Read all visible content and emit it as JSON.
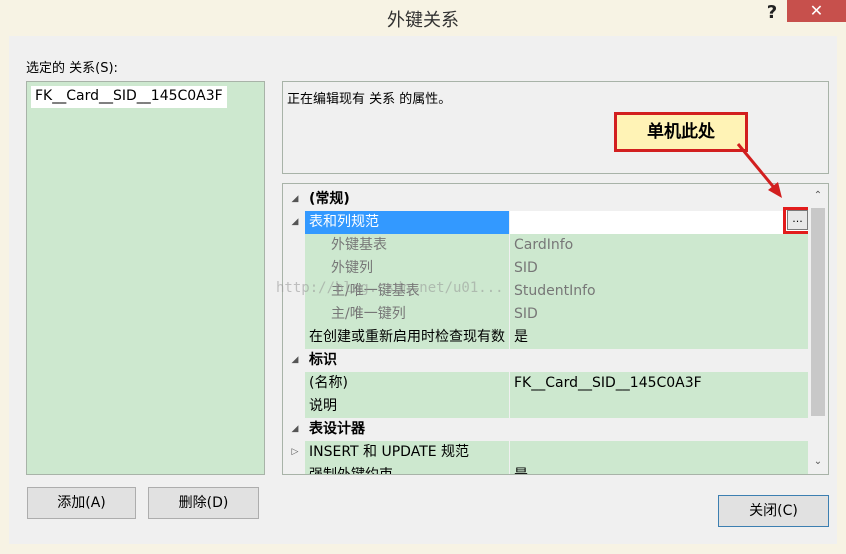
{
  "window": {
    "title": "外键关系",
    "help_label": "?",
    "close_label": "✕"
  },
  "relations": {
    "label": "选定的 关系(S):",
    "items": [
      "FK__Card__SID__145C0A3F"
    ]
  },
  "description": "正在编辑现有 关系 的属性。",
  "callout": "单机此处",
  "properties": {
    "cat_general": "(常规)",
    "table_col_spec": "表和列规范",
    "ellipsis": "...",
    "fk_base_table_label": "外键基表",
    "fk_base_table_value": "CardInfo",
    "fk_columns_label": "外键列",
    "fk_columns_value": "SID",
    "pk_base_table_label": "主/唯一键基表",
    "pk_base_table_value": "StudentInfo",
    "pk_columns_label": "主/唯一键列",
    "pk_columns_value": "SID",
    "check_existing_label": "在创建或重新启用时检查现有数",
    "check_existing_value": "是",
    "cat_identity": "标识",
    "name_label": "(名称)",
    "name_value": "FK__Card__SID__145C0A3F",
    "desc_label": "说明",
    "desc_value": "",
    "cat_designer": "表设计器",
    "insert_update_label": "INSERT 和 UPDATE 规范",
    "insert_update_value": "",
    "enforce_label": "强制外键约束",
    "enforce_value": "是"
  },
  "buttons": {
    "add": "添加(A)",
    "delete": "删除(D)",
    "close": "关闭(C)"
  },
  "watermark": "http://blog.csdn.net/u01..."
}
